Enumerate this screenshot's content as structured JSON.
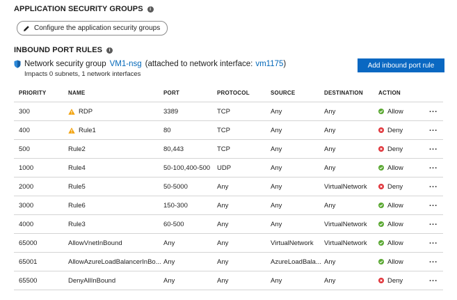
{
  "asg": {
    "title": "APPLICATION SECURITY GROUPS",
    "configure_label": "Configure the application security groups"
  },
  "inbound": {
    "title": "INBOUND PORT RULES",
    "nsg_prefix": "Network security group",
    "nsg_name": "VM1-nsg",
    "attached_prefix": "(attached to network interface:",
    "nic_name": "vm1175",
    "attached_suffix": ")",
    "impacts": "Impacts 0 subnets, 1 network interfaces",
    "add_label": "Add inbound port rule"
  },
  "columns": {
    "priority": "PRIORITY",
    "name": "NAME",
    "port": "PORT",
    "protocol": "PROTOCOL",
    "source": "SOURCE",
    "destination": "DESTINATION",
    "action": "ACTION"
  },
  "rows": [
    {
      "priority": "300",
      "name": "RDP",
      "warning": true,
      "port": "3389",
      "protocol": "TCP",
      "source": "Any",
      "destination": "Any",
      "action": "Allow",
      "more": "..."
    },
    {
      "priority": "400",
      "name": "Rule1",
      "warning": true,
      "port": "80",
      "protocol": "TCP",
      "source": "Any",
      "destination": "Any",
      "action": "Deny",
      "more": "..."
    },
    {
      "priority": "500",
      "name": "Rule2",
      "warning": false,
      "port": "80,443",
      "protocol": "TCP",
      "source": "Any",
      "destination": "Any",
      "action": "Deny",
      "more": "..."
    },
    {
      "priority": "1000",
      "name": "Rule4",
      "warning": false,
      "port": "50-100,400-500",
      "protocol": "UDP",
      "source": "Any",
      "destination": "Any",
      "action": "Allow",
      "more": "..."
    },
    {
      "priority": "2000",
      "name": "Rule5",
      "warning": false,
      "port": "50-5000",
      "protocol": "Any",
      "source": "Any",
      "destination": "VirtualNetwork",
      "action": "Deny",
      "more": "..."
    },
    {
      "priority": "3000",
      "name": "Rule6",
      "warning": false,
      "port": "150-300",
      "protocol": "Any",
      "source": "Any",
      "destination": "Any",
      "action": "Allow",
      "more": "..."
    },
    {
      "priority": "4000",
      "name": "Rule3",
      "warning": false,
      "port": "60-500",
      "protocol": "Any",
      "source": "Any",
      "destination": "VirtualNetwork",
      "action": "Allow",
      "more": "..."
    },
    {
      "priority": "65000",
      "name": "AllowVnetInBound",
      "warning": false,
      "port": "Any",
      "protocol": "Any",
      "source": "VirtualNetwork",
      "destination": "VirtualNetwork",
      "action": "Allow",
      "more": "..."
    },
    {
      "priority": "65001",
      "name": "AllowAzureLoadBalancerInBo...",
      "warning": false,
      "port": "Any",
      "protocol": "Any",
      "source": "AzureLoadBala...",
      "destination": "Any",
      "action": "Allow",
      "more": "..."
    },
    {
      "priority": "65500",
      "name": "DenyAllInBound",
      "warning": false,
      "port": "Any",
      "protocol": "Any",
      "source": "Any",
      "destination": "Any",
      "action": "Deny",
      "more": "..."
    }
  ],
  "colors": {
    "allow": "#5aa832",
    "deny": "#e0343a",
    "warning": "#f2a20c",
    "link": "#0066b8",
    "primary_button": "#0a68c2"
  },
  "icons": {
    "info": "info-icon",
    "pencil": "pencil-icon",
    "shield": "shield-icon",
    "warning": "warning-icon",
    "allow": "check-circle-icon",
    "deny": "x-circle-icon",
    "more": "ellipsis-icon"
  }
}
